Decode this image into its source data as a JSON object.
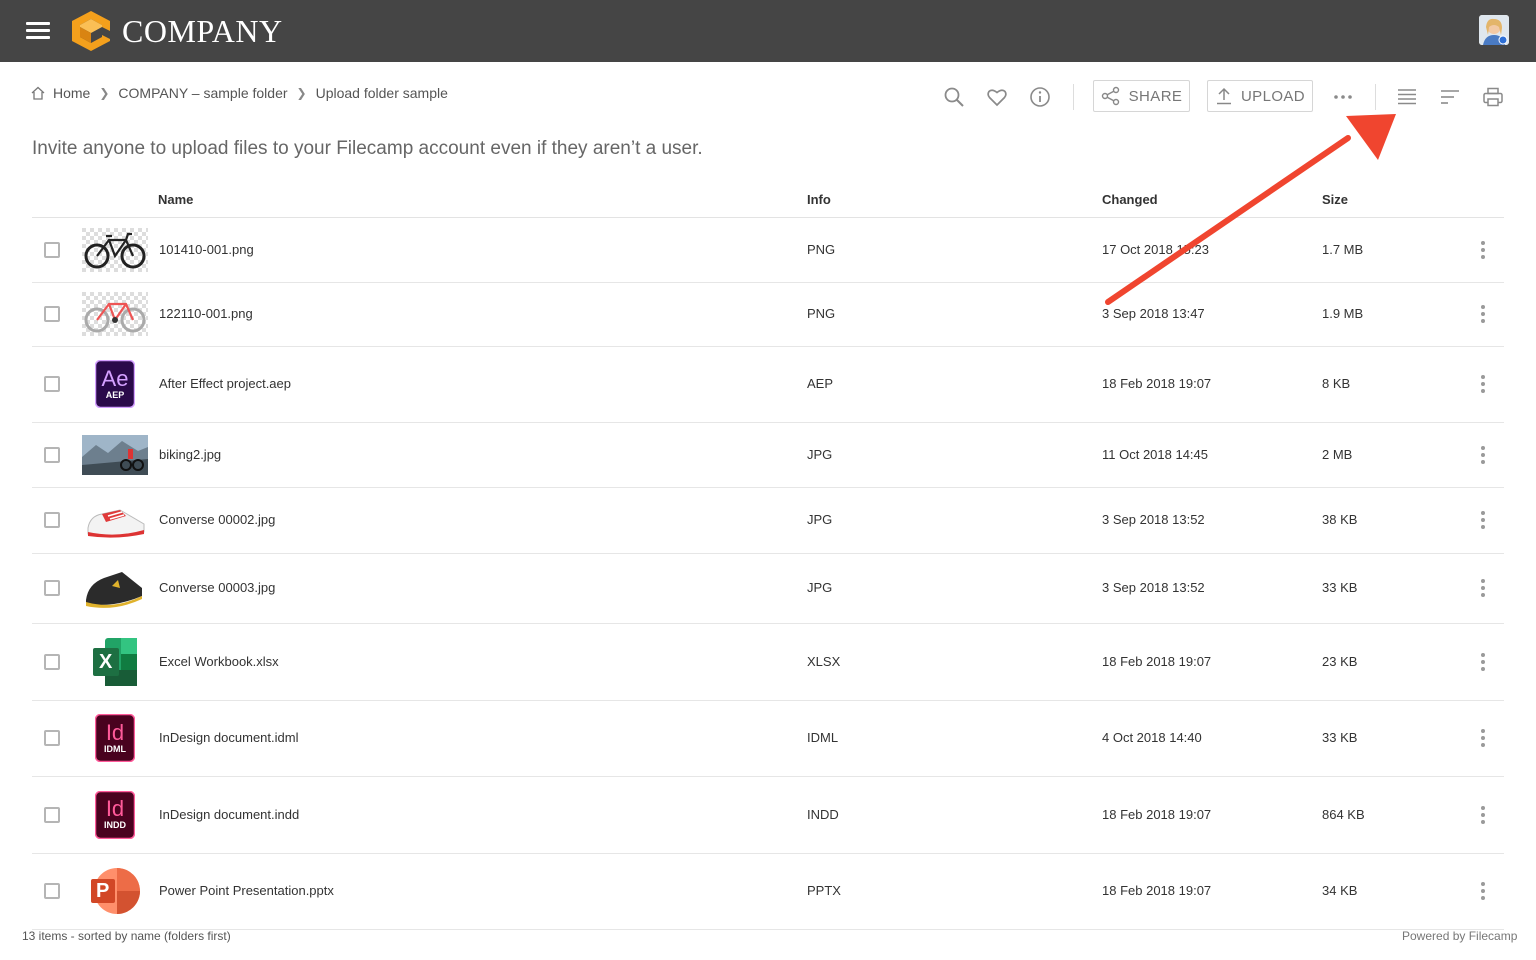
{
  "header": {
    "brand": "COMPANY",
    "menu_icon": "hamburger-menu-icon",
    "logo_icon": "company-logo-icon",
    "avatar_icon": "user-avatar",
    "background": "#454545"
  },
  "breadcrumb": {
    "home": "Home",
    "items": [
      "COMPANY – sample folder",
      "Upload folder sample"
    ]
  },
  "toolbar": {
    "share_label": "SHARE",
    "upload_label": "UPLOAD"
  },
  "tagline": "Invite anyone to upload files to your Filecamp account even if they aren’t a user.",
  "table": {
    "headers": {
      "name": "Name",
      "info": "Info",
      "changed": "Changed",
      "size": "Size"
    },
    "rows": [
      {
        "name": "101410-001.png",
        "info": "PNG",
        "changed": "17 Oct 2018 15:23",
        "size": "1.7 MB",
        "thumb": "bike-black"
      },
      {
        "name": "122110-001.png",
        "info": "PNG",
        "changed": "3 Sep 2018 13:47",
        "size": "1.9 MB",
        "thumb": "bike-white"
      },
      {
        "name": "After Effect project.aep",
        "info": "AEP",
        "changed": "18 Feb 2018 19:07",
        "size": "8 KB",
        "thumb": "ae",
        "badge_main": "Ae",
        "badge_sub": "AEP"
      },
      {
        "name": "biking2.jpg",
        "info": "JPG",
        "changed": "11 Oct 2018 14:45",
        "size": "2 MB",
        "thumb": "photo-biking"
      },
      {
        "name": "Converse 00002.jpg",
        "info": "JPG",
        "changed": "3 Sep 2018 13:52",
        "size": "38 KB",
        "thumb": "shoe-red"
      },
      {
        "name": "Converse 00003.jpg",
        "info": "JPG",
        "changed": "3 Sep 2018 13:52",
        "size": "33 KB",
        "thumb": "shoe-dark"
      },
      {
        "name": "Excel Workbook.xlsx",
        "info": "XLSX",
        "changed": "18 Feb 2018 19:07",
        "size": "23 KB",
        "thumb": "excel",
        "badge_main": "X"
      },
      {
        "name": "InDesign document.idml",
        "info": "IDML",
        "changed": "4 Oct 2018 14:40",
        "size": "33 KB",
        "thumb": "id",
        "badge_main": "Id",
        "badge_sub": "IDML"
      },
      {
        "name": "InDesign document.indd",
        "info": "INDD",
        "changed": "18 Feb 2018 19:07",
        "size": "864 KB",
        "thumb": "id",
        "badge_main": "Id",
        "badge_sub": "INDD"
      },
      {
        "name": "Power Point Presentation.pptx",
        "info": "PPTX",
        "changed": "18 Feb 2018 19:07",
        "size": "34 KB",
        "thumb": "ppt",
        "badge_main": "P"
      }
    ]
  },
  "footer": {
    "status": "13 items - sorted by name (folders first)",
    "powered": "Powered by Filecamp"
  },
  "colors": {
    "accent_arrow": "#f0452f",
    "ae_purple": "#2a0a4a",
    "indesign": "#49021f",
    "excel_green": "#1d6f42",
    "ppt_orange": "#d24726"
  }
}
